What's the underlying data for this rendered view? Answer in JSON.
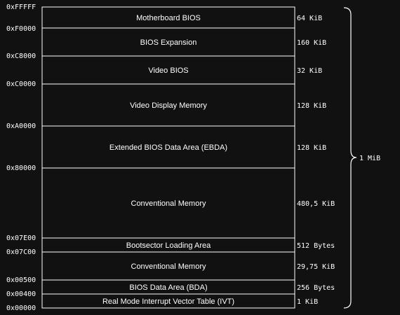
{
  "diagram": {
    "addresses": [
      "0xFFFFF",
      "0xF0000",
      "0xC8000",
      "0xC0000",
      "0xA0000",
      "0x80000",
      "0x07E00",
      "0x07C00",
      "0x00500",
      "0x00400",
      "0x00000"
    ],
    "regions": [
      {
        "name": "Motherboard BIOS",
        "size": "64 KiB"
      },
      {
        "name": "BIOS Expansion",
        "size": "160 KiB"
      },
      {
        "name": "Video BIOS",
        "size": "32 KiB"
      },
      {
        "name": "Video Display Memory",
        "size": "128 KiB"
      },
      {
        "name": "Extended BIOS Data Area (EBDA)",
        "size": "128 KiB"
      },
      {
        "name": "Conventional Memory",
        "size": "480,5 KiB"
      },
      {
        "name": "Bootsector Loading Area",
        "size": "512 Bytes"
      },
      {
        "name": "Conventional Memory",
        "size": "29,75 KiB"
      },
      {
        "name": "BIOS Data Area (BDA)",
        "size": "256 Bytes"
      },
      {
        "name": "Real Mode Interrupt Vector Table (IVT)",
        "size": "1 KiB"
      }
    ],
    "total": "1 MiB"
  }
}
